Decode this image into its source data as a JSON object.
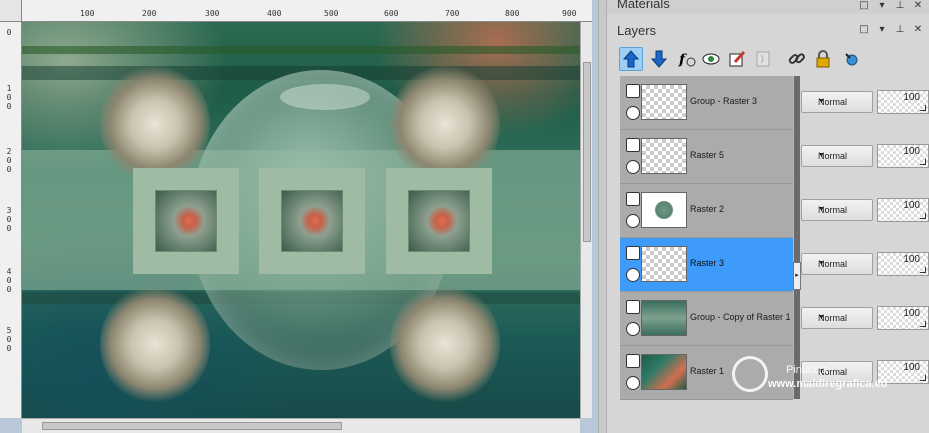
{
  "ruler": {
    "top_labels": [
      "100",
      "200",
      "300",
      "400",
      "500",
      "600",
      "700",
      "800",
      "900"
    ],
    "left_labels": [
      "0",
      "1\n0\n0",
      "2\n0\n0",
      "3\n0\n0",
      "4\n0\n0",
      "5\n0\n0"
    ]
  },
  "panels": {
    "materials_title": "Materials",
    "layers_title": "Layers"
  },
  "header_buttons": {
    "restore": "□",
    "menu": "▾",
    "pin": "⊥",
    "close": "✕"
  },
  "toolbar": {
    "icons": [
      "arrow-up-icon",
      "arrow-down-icon",
      "fx-icon",
      "eye-mask-icon",
      "edit-icon",
      "script-icon",
      "link-icon",
      "lock-icon",
      "pin-icon"
    ]
  },
  "layers": [
    {
      "name": "Group - Raster 3",
      "blend": "Normal",
      "opacity": "100",
      "selected": false
    },
    {
      "name": "Raster 5",
      "blend": "Normal",
      "opacity": "100",
      "selected": false
    },
    {
      "name": "Raster 2",
      "blend": "Normal",
      "opacity": "100",
      "selected": false
    },
    {
      "name": "Raster 3",
      "blend": "Normal",
      "opacity": "100",
      "selected": true
    },
    {
      "name": "Group - Copy of Raster 1",
      "blend": "Normal",
      "opacity": "100",
      "selected": false
    },
    {
      "name": "Raster 1",
      "blend": "Normal",
      "opacity": "100",
      "selected": false
    }
  ],
  "watermark": {
    "name": "Pinuccia",
    "site": "www.maidiregrafica.eu"
  },
  "colors": {
    "selected_row": "#3e9bfa",
    "active_button": "#9ccff3",
    "frame": "#9fbba4"
  }
}
